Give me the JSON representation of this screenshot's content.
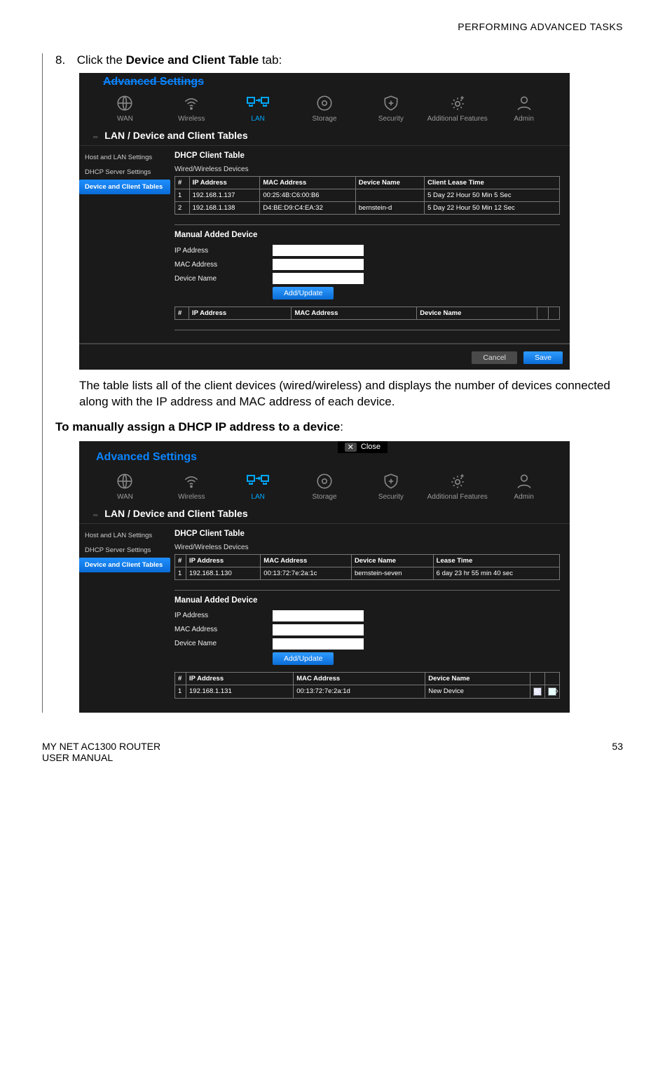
{
  "header": {
    "section": "PERFORMING ADVANCED TASKS"
  },
  "step": {
    "number": "8.",
    "text_prefix": "Click the ",
    "text_bold": "Device and Client Table",
    "text_suffix": " tab:"
  },
  "caption1": "The table lists all of the client devices (wired/wireless) and displays the number of devices connected along with the IP address and MAC address of each device.",
  "heading2_prefix": "To manually assign a DHCP IP address to a device",
  "heading2_suffix": ":",
  "nav": {
    "wan": "WAN",
    "wireless": "Wireless",
    "lan": "LAN",
    "storage": "Storage",
    "security": "Security",
    "additional": "Additional Features",
    "admin": "Admin"
  },
  "screenshot1": {
    "title": "Advanced Settings",
    "section": "LAN / Device and Client Tables",
    "sidebar": {
      "item0": "Host and LAN Settings",
      "item1": "DHCP Server Settings",
      "item2": "Device and Client Tables"
    },
    "sub_h": "DHCP Client Table",
    "sub_cap": "Wired/Wireless Devices",
    "headers": {
      "n": "#",
      "ip": "IP Address",
      "mac": "MAC Address",
      "name": "Device Name",
      "lease": "Client Lease Time"
    },
    "rows": [
      {
        "n": "1",
        "ip": "192.168.1.137",
        "mac": "00:25:4B:C6:00:B6",
        "name": "",
        "lease": "5 Day 22 Hour 50 Min 5 Sec"
      },
      {
        "n": "2",
        "ip": "192.168.1.138",
        "mac": "D4:BE:D9:C4:EA:32",
        "name": "bernstein-d",
        "lease": "5 Day 22 Hour 50 Min 12 Sec"
      }
    ],
    "manual_h": "Manual Added Device",
    "form": {
      "ip": "IP Address",
      "mac": "MAC Address",
      "name": "Device Name",
      "btn": "Add/Update"
    },
    "empty_headers": {
      "n": "#",
      "ip": "IP Address",
      "mac": "MAC Address",
      "name": "Device Name"
    },
    "buttons": {
      "cancel": "Cancel",
      "save": "Save"
    }
  },
  "screenshot2": {
    "close": "Close",
    "title": "Advanced Settings",
    "section": "LAN / Device and Client Tables",
    "sidebar": {
      "item0": "Host and LAN Settings",
      "item1": "DHCP Server Settings",
      "item2": "Device and Client Tables"
    },
    "sub_h": "DHCP Client Table",
    "sub_cap": "Wired/Wireless Devices",
    "headers": {
      "n": "#",
      "ip": "IP Address",
      "mac": "MAC Address",
      "name": "Device Name",
      "lease": "Lease Time"
    },
    "rows": [
      {
        "n": "1",
        "ip": "192.168.1.130",
        "mac": "00:13:72:7e:2a:1c",
        "name": "bernstein-seven",
        "lease": "6 day 23 hr 55 min 40 sec"
      }
    ],
    "manual_h": "Manual Added Device",
    "form": {
      "ip": "IP Address",
      "mac": "MAC Address",
      "name": "Device Name",
      "btn": "Add/Update"
    },
    "manual_headers": {
      "n": "#",
      "ip": "IP Address",
      "mac": "MAC Address",
      "name": "Device Name"
    },
    "manual_rows": [
      {
        "n": "1",
        "ip": "192.168.1.131",
        "mac": "00:13:72:7e:2a:1d",
        "name": "New Device"
      }
    ]
  },
  "footer": {
    "line1": "MY NET AC1300 ROUTER",
    "line2": "USER MANUAL",
    "page": "53"
  }
}
